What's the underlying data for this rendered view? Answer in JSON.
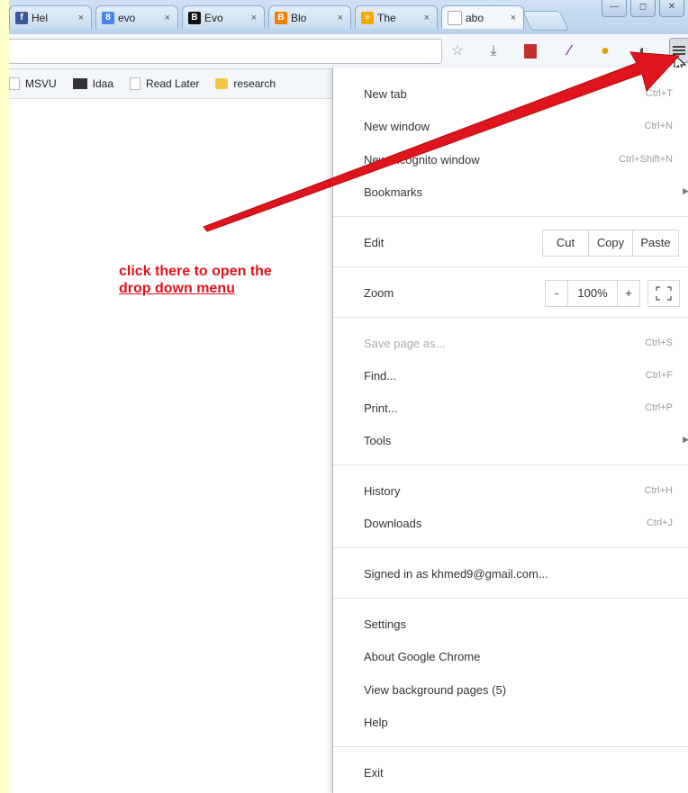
{
  "tabs": [
    {
      "title": "Hel",
      "icon": "facebook-icon",
      "color": "#3b5998",
      "glyph": "f"
    },
    {
      "title": "evo",
      "icon": "google-icon",
      "color": "#4a86e8",
      "glyph": "8"
    },
    {
      "title": "Evo",
      "icon": "blackberry-icon",
      "color": "#111111",
      "glyph": "B"
    },
    {
      "title": "Blo",
      "icon": "blogger-icon",
      "color": "#f57d00",
      "glyph": "B"
    },
    {
      "title": "The",
      "icon": "stripes-icon",
      "color": "#f2a900",
      "glyph": "≡"
    },
    {
      "title": "abo",
      "icon": "page-icon",
      "color": "#ffffff",
      "glyph": ""
    }
  ],
  "tab_close": "×",
  "bookmarks": [
    {
      "label": "MSVU",
      "icon": "page-icon"
    },
    {
      "label": "Idaa",
      "icon": "site-icon"
    },
    {
      "label": "Read Later",
      "icon": "page-icon"
    },
    {
      "label": "research",
      "icon": "folder-icon"
    }
  ],
  "menu": {
    "new_tab": {
      "label": "New tab",
      "shortcut": "Ctrl+T"
    },
    "new_window": {
      "label": "New window",
      "shortcut": "Ctrl+N"
    },
    "incognito": {
      "label": "New incognito window",
      "shortcut": "Ctrl+Shift+N"
    },
    "bookmarks": {
      "label": "Bookmarks"
    },
    "edit": {
      "label": "Edit",
      "cut": "Cut",
      "copy": "Copy",
      "paste": "Paste"
    },
    "zoom": {
      "label": "Zoom",
      "minus": "-",
      "value": "100%",
      "plus": "+"
    },
    "save_page": {
      "label": "Save page as...",
      "shortcut": "Ctrl+S"
    },
    "find": {
      "label": "Find...",
      "shortcut": "Ctrl+F"
    },
    "print": {
      "label": "Print...",
      "shortcut": "Ctrl+P"
    },
    "tools": {
      "label": "Tools"
    },
    "history": {
      "label": "History",
      "shortcut": "Ctrl+H"
    },
    "downloads": {
      "label": "Downloads",
      "shortcut": "Ctrl+J"
    },
    "signed_in": {
      "label": "Signed in as khmed9@gmail.com..."
    },
    "settings": {
      "label": "Settings"
    },
    "about": {
      "label": "About Google Chrome"
    },
    "background_pages": {
      "label": "View background pages (5)"
    },
    "help": {
      "label": "Help"
    },
    "exit": {
      "label": "Exit"
    }
  },
  "annotation": {
    "line1": "click  there to open the",
    "line2": "drop down menu",
    "color": "#e0141c"
  }
}
